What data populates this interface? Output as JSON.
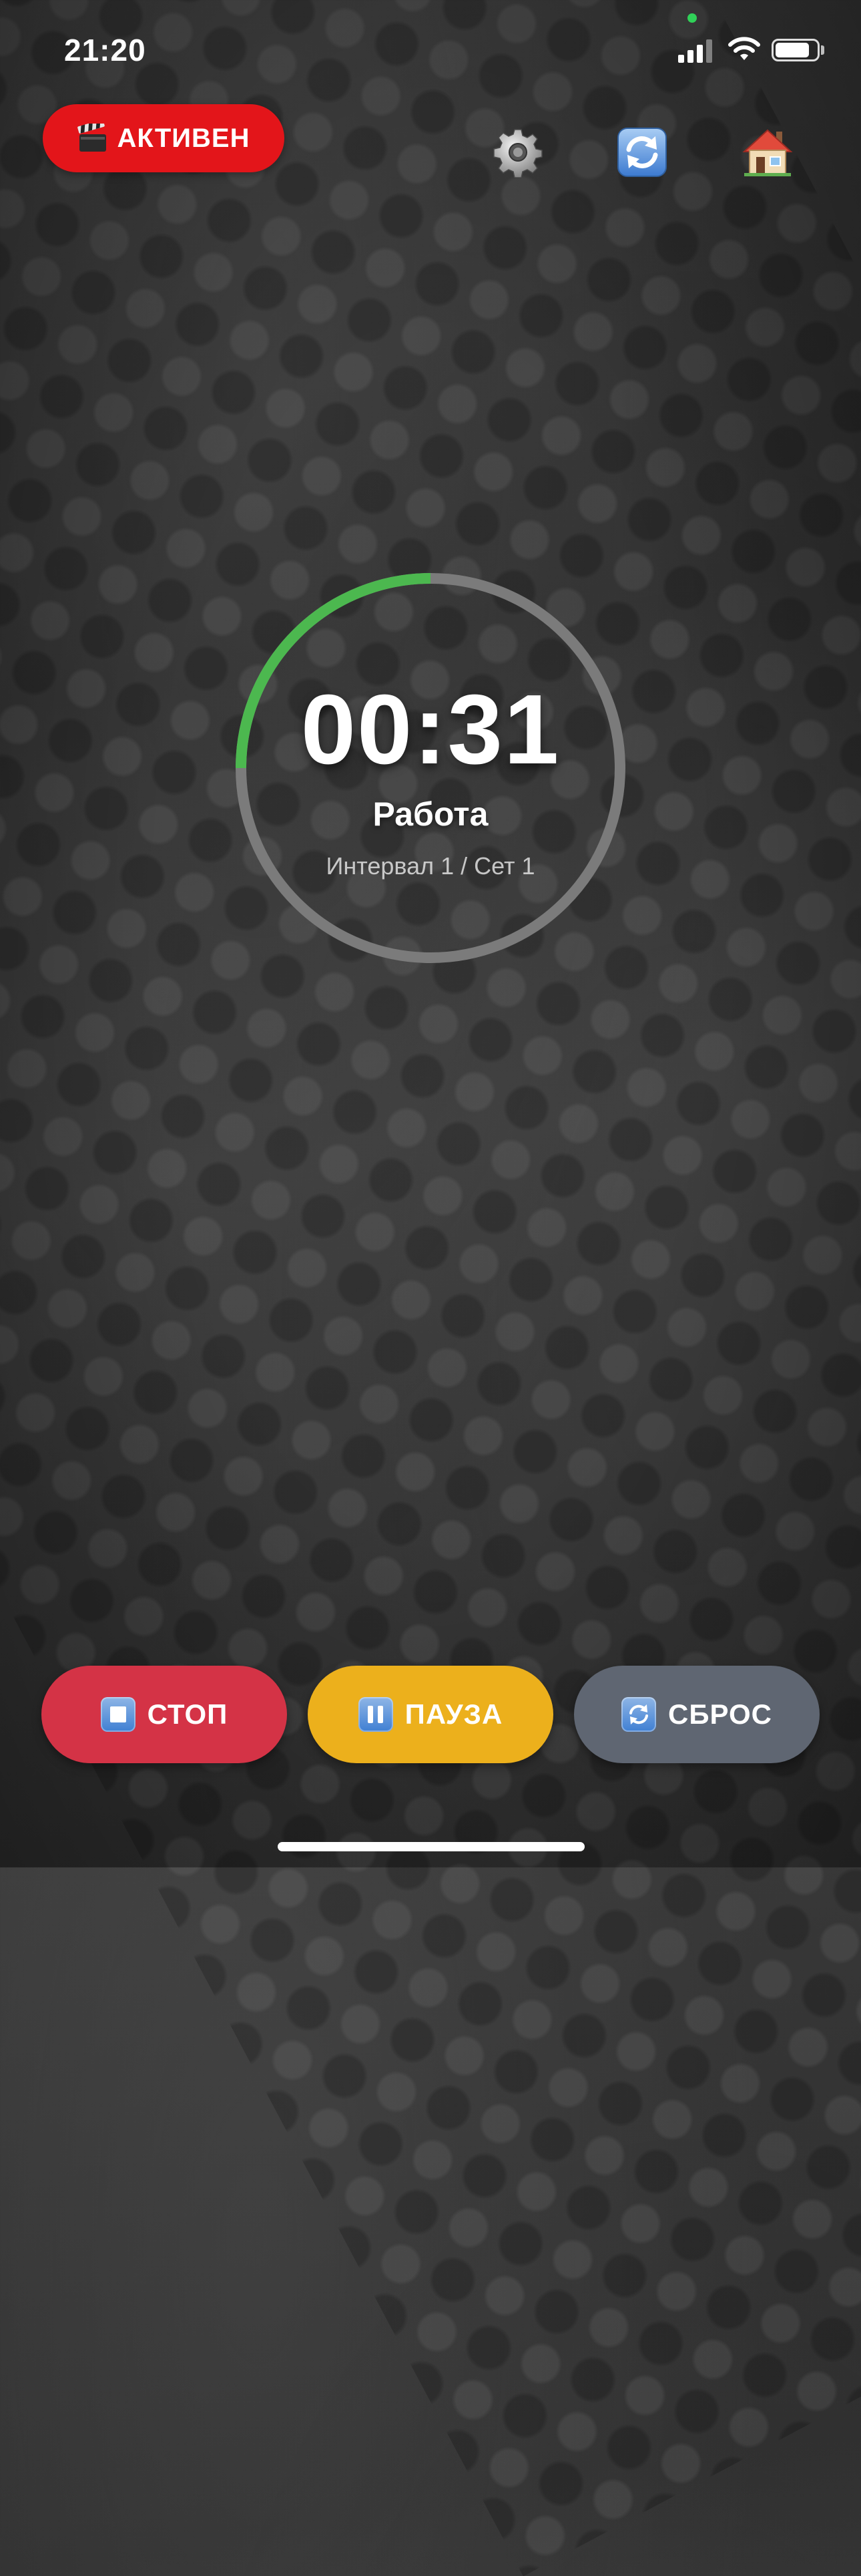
{
  "status_bar": {
    "time": "21:20",
    "signal_bars": 3,
    "battery_level": 0.84
  },
  "header": {
    "status_badge": "АКТИВЕН",
    "status_badge_icon": "clapperboard-icon",
    "status_badge_color": "#e3151a",
    "icons": [
      "gear-icon",
      "refresh-icon",
      "house-icon"
    ]
  },
  "timer": {
    "time": "00:31",
    "phase": "Работа",
    "interval_info": "Интервал 1 / Сет 1",
    "progress_fraction": 0.25,
    "progress_color": "#4cb84f",
    "track_color": "#7b7b7b"
  },
  "controls": {
    "stop_label": "СТОП",
    "pause_label": "ПАУЗА",
    "reset_label": "СБРОС",
    "stop_icon": "stop-icon",
    "pause_icon": "pause-icon",
    "reset_icon": "reset-icon",
    "stop_color": "#d43346",
    "pause_color": "#ecb01c",
    "reset_color": "#5f6672"
  }
}
